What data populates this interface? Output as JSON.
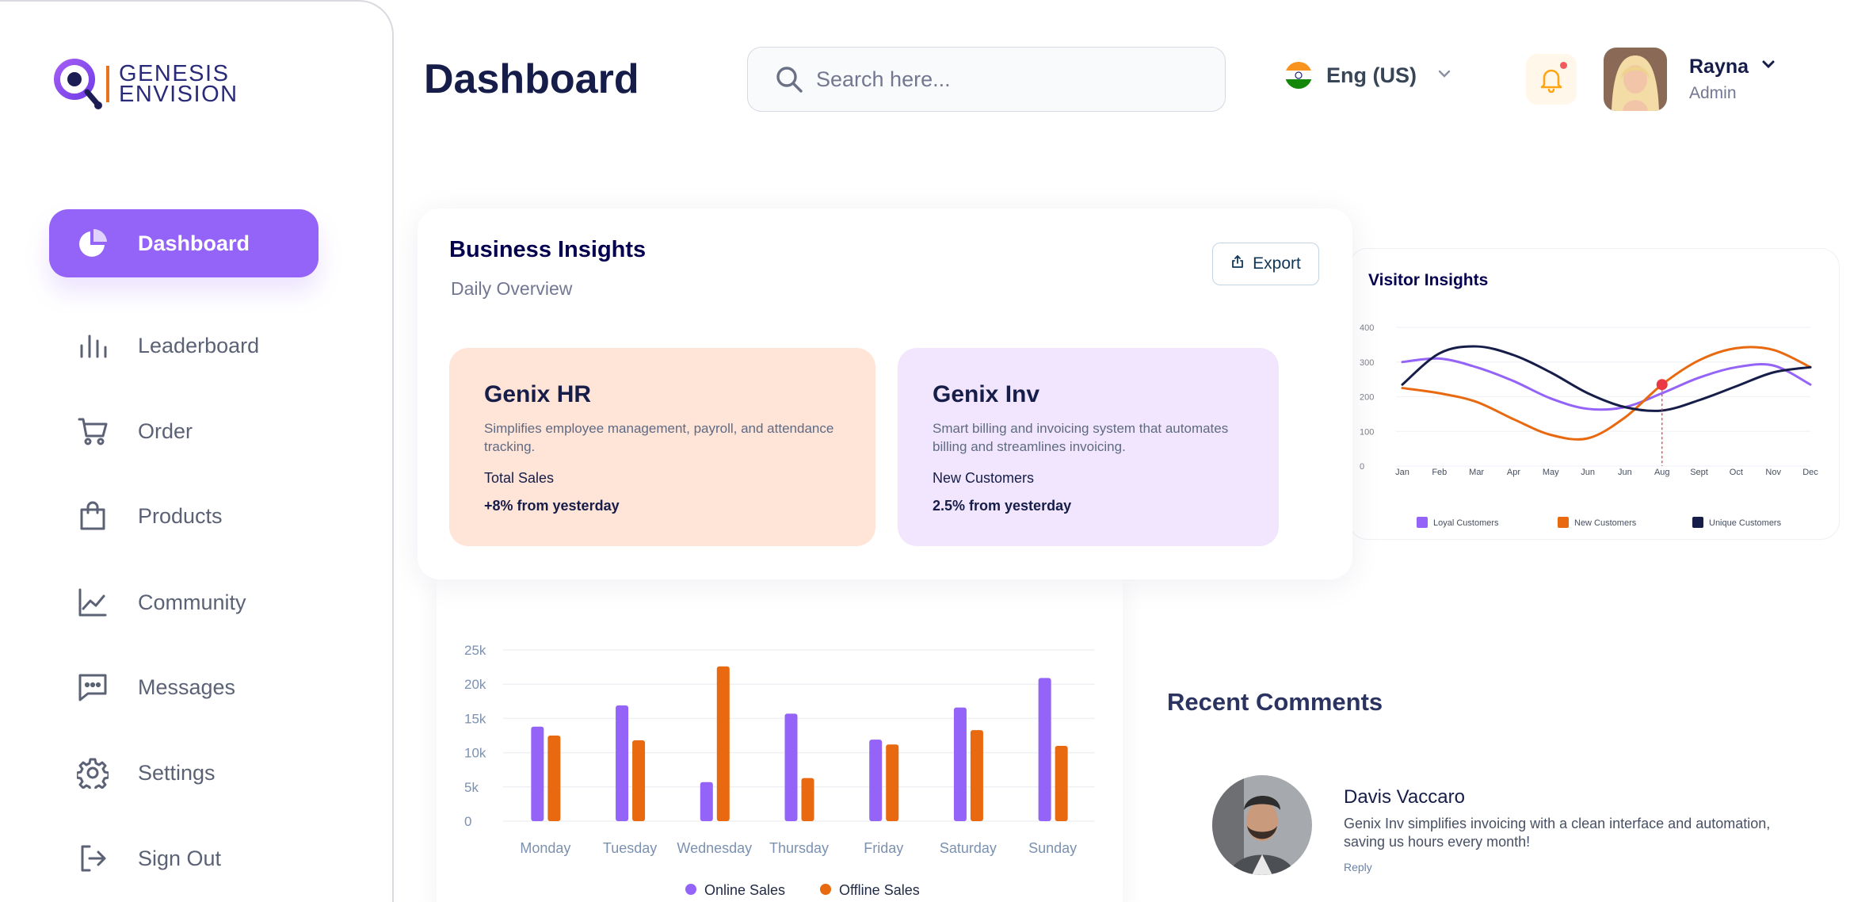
{
  "brand": {
    "line1": "GENESIS",
    "line2": "ENVISION"
  },
  "sidebar": {
    "items": [
      {
        "label": "Dashboard",
        "icon": "pie-chart-icon",
        "active": true
      },
      {
        "label": "Leaderboard",
        "icon": "bar-chart-icon"
      },
      {
        "label": "Order",
        "icon": "cart-icon"
      },
      {
        "label": "Products",
        "icon": "shopping-bag-icon"
      },
      {
        "label": "Community",
        "icon": "line-chart-icon"
      },
      {
        "label": "Messages",
        "icon": "message-icon"
      },
      {
        "label": "Settings",
        "icon": "gear-icon"
      },
      {
        "label": "Sign Out",
        "icon": "sign-out-icon"
      }
    ]
  },
  "header": {
    "title": "Dashboard",
    "search_placeholder": "Search here...",
    "language": "Eng (US)",
    "user": {
      "name": "Rayna",
      "role": "Admin"
    }
  },
  "business_insights": {
    "title": "Business Insights",
    "subtitle": "Daily Overview",
    "export_label": "Export",
    "products": [
      {
        "name": "Genix HR",
        "description": "Simplifies employee management, payroll, and attendance tracking.",
        "stat_label": "Total Sales",
        "stat_value": "+8% from yesterday"
      },
      {
        "name": "Genix Inv",
        "description": "Smart billing and invoicing system that automates billing and streamlines invoicing.",
        "stat_label": "New Customers",
        "stat_value": "2.5% from yesterday"
      }
    ]
  },
  "recent_comments": {
    "title": "Recent Comments",
    "items": [
      {
        "name": "Davis Vaccaro",
        "text": "Genix Inv simplifies invoicing with a clean interface and automation, saving us hours every month!",
        "reply": "Reply"
      }
    ]
  },
  "colors": {
    "purple": "#9463f7",
    "orange": "#e8690f",
    "navy": "#151d48"
  },
  "chart_data": [
    {
      "type": "line",
      "title": "Visitor Insights",
      "categories": [
        "Jan",
        "Feb",
        "Mar",
        "Apr",
        "May",
        "Jun",
        "Jun",
        "Aug",
        "Sept",
        "Oct",
        "Nov",
        "Dec"
      ],
      "ylim": [
        0,
        400
      ],
      "yticks": [
        "0",
        "100",
        "200",
        "300",
        "400"
      ],
      "grid": true,
      "legend": "bottom",
      "series": [
        {
          "name": "Loyal Customers",
          "color": "#9463f7",
          "values": [
            300,
            310,
            285,
            245,
            195,
            165,
            170,
            210,
            255,
            285,
            290,
            235
          ]
        },
        {
          "name": "New Customers",
          "color": "#e8690f",
          "values": [
            225,
            210,
            185,
            135,
            90,
            80,
            140,
            235,
            305,
            340,
            335,
            285
          ]
        },
        {
          "name": "Unique Customers",
          "color": "#151d48",
          "values": [
            235,
            325,
            345,
            320,
            270,
            210,
            170,
            160,
            190,
            230,
            270,
            285
          ]
        }
      ],
      "highlight": {
        "category_index": 7,
        "series": "New Customers"
      }
    },
    {
      "type": "bar",
      "categories": [
        "Monday",
        "Tuesday",
        "Wednesday",
        "Thursday",
        "Friday",
        "Saturday",
        "Sunday"
      ],
      "ylim": [
        0,
        25000
      ],
      "yticks": [
        "0",
        "5k",
        "10k",
        "15k",
        "20k",
        "25k"
      ],
      "grid": true,
      "legend": "bottom",
      "series": [
        {
          "name": "Online Sales",
          "color": "#9463f7",
          "values": [
            13800,
            16900,
            5700,
            15700,
            11900,
            16600,
            20900
          ]
        },
        {
          "name": "Offline Sales",
          "color": "#e8690f",
          "values": [
            12500,
            11800,
            22600,
            6300,
            11200,
            13300,
            11000
          ]
        }
      ]
    }
  ]
}
